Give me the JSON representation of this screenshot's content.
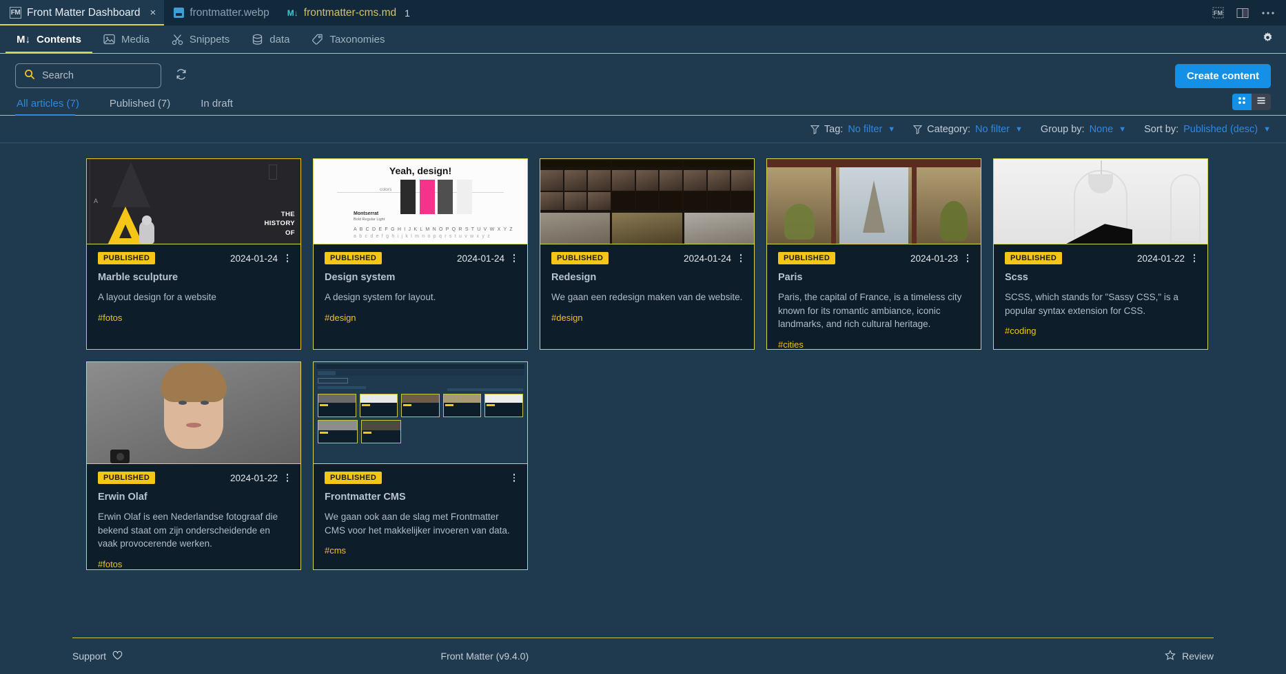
{
  "titlebar": {
    "tabs": [
      {
        "label": "Front Matter Dashboard",
        "icon": "fm-icon",
        "close": "×",
        "badge": ""
      },
      {
        "label": "frontmatter.webp",
        "icon": "image-icon",
        "badge": ""
      },
      {
        "label": "frontmatter-cms.md",
        "icon": "markdown-icon",
        "badge": "1"
      }
    ],
    "actions": [
      "fm-panel-icon",
      "split-editor-icon",
      "more-actions-icon"
    ]
  },
  "nav": {
    "items": [
      {
        "label": "Contents",
        "icon": "markdown-icon",
        "active": true
      },
      {
        "label": "Media",
        "icon": "image-icon",
        "active": false
      },
      {
        "label": "Snippets",
        "icon": "scissors-icon",
        "active": false
      },
      {
        "label": "data",
        "icon": "database-icon",
        "active": false
      },
      {
        "label": "Taxonomies",
        "icon": "tag-icon",
        "active": false
      }
    ],
    "settings_icon": "gear-icon"
  },
  "toolbar": {
    "search_placeholder": "Search",
    "search_value": "",
    "search_icon": "search-icon",
    "refresh_icon": "refresh-icon",
    "create_label": "Create content"
  },
  "subtabs": [
    {
      "label": "All articles (7)",
      "active": true
    },
    {
      "label": "Published (7)",
      "active": false
    },
    {
      "label": "In draft",
      "active": false
    }
  ],
  "view_toggles": [
    {
      "name": "grid-view",
      "active": true
    },
    {
      "name": "list-view",
      "active": false
    }
  ],
  "filters": [
    {
      "icon": "funnel-icon",
      "label": "Tag:",
      "value": "No filter"
    },
    {
      "icon": "funnel-icon",
      "label": "Category:",
      "value": "No filter"
    },
    {
      "icon": "",
      "label": "Group by:",
      "value": "None"
    },
    {
      "icon": "",
      "label": "Sort by:",
      "value": "Published (desc)"
    }
  ],
  "cards": [
    {
      "status": "PUBLISHED",
      "date": "2024-01-24",
      "title": "Marble sculpture",
      "description": "A layout design for a website",
      "tags": "#fotos",
      "thumb": "marble-sculpture-thumbnail",
      "selected": true,
      "thumb_text": {
        "line1": "THE",
        "line2": "HISTORY",
        "line3": "OF",
        "letter": "A"
      }
    },
    {
      "status": "PUBLISHED",
      "date": "2024-01-24",
      "title": "Design system",
      "description": "A design system for layout.",
      "tags": "#design",
      "thumb": "design-system-thumbnail",
      "selected": false,
      "thumb_text": {
        "heading": "Yeah, design!",
        "colors_label": "colors",
        "font_name": "Montserrat",
        "font_meta": "Bold  Regular  Light",
        "upper": "A B C D E F G H I J K L M N O P Q R S T U V W X Y Z",
        "lower": "a b c d e f g h i j k l m n o p q r s t u v w x y z"
      }
    },
    {
      "status": "PUBLISHED",
      "date": "2024-01-24",
      "title": "Redesign",
      "description": "We gaan een redesign maken van de website.",
      "tags": "#design",
      "thumb": "redesign-thumbnail",
      "selected": false
    },
    {
      "status": "PUBLISHED",
      "date": "2024-01-23",
      "title": "Paris",
      "description": "Paris, the capital of France, is a timeless city known for its romantic ambiance, iconic landmarks, and rich cultural heritage.",
      "tags": "#cities",
      "thumb": "paris-eiffel-tower-thumbnail",
      "selected": false
    },
    {
      "status": "PUBLISHED",
      "date": "2024-01-22",
      "title": "Scss",
      "description": "SCSS, which stands for \"Sassy CSS,\" is a popular syntax extension for CSS.",
      "tags": "#coding",
      "thumb": "scss-white-room-piano-thumbnail",
      "selected": false
    },
    {
      "status": "PUBLISHED",
      "date": "2024-01-22",
      "title": "Erwin Olaf",
      "description": "Erwin Olaf is een Nederlandse fotograaf die bekend staat om zijn onderscheidende en vaak provocerende werken.",
      "tags": "#fotos",
      "thumb": "erwin-olaf-portrait-thumbnail",
      "selected": false
    },
    {
      "status": "PUBLISHED",
      "date": "",
      "title": "Frontmatter CMS",
      "description": "We gaan ook aan de slag met Frontmatter CMS voor het makkelijker invoeren van data.",
      "tags": "#cms",
      "thumb": "frontmatter-cms-dashboard-thumbnail",
      "selected": false
    }
  ],
  "footer": {
    "support_label": "Support",
    "support_icon": "heart-icon",
    "version": "Front Matter (v9.4.0)",
    "review_label": "Review",
    "review_icon": "star-icon"
  },
  "colors": {
    "page_bg": "#1f3a4f",
    "titlebar_bg": "#12293b",
    "card_bg": "#0e1d2a",
    "accent_yellow": "#d9d64b",
    "pill_yellow": "#f5c518",
    "link_blue": "#2f88e0",
    "button_blue": "#1490e6"
  }
}
